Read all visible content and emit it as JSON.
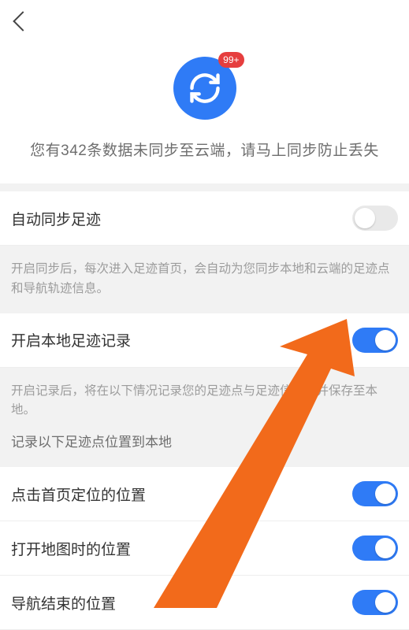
{
  "sync": {
    "badge": "99+",
    "message": "您有342条数据未同步至云端，请马上同步防止丢失"
  },
  "settings": {
    "auto_sync": {
      "label": "自动同步足迹",
      "on": false
    },
    "auto_sync_desc": "开启同步后，每次进入足迹首页，会自动为您同步本地和云端的足迹点和导航轨迹信息。",
    "local_record": {
      "label": "开启本地足迹记录",
      "on": true
    },
    "local_record_desc": "开启记录后，将在以下情况记录您的足迹点与足迹信息，并保存至本地。",
    "section_title": "记录以下足迹点位置到本地",
    "items": [
      {
        "label": "点击首页定位的位置",
        "on": true
      },
      {
        "label": "打开地图时的位置",
        "on": true
      },
      {
        "label": "导航结束的位置",
        "on": true
      }
    ]
  }
}
